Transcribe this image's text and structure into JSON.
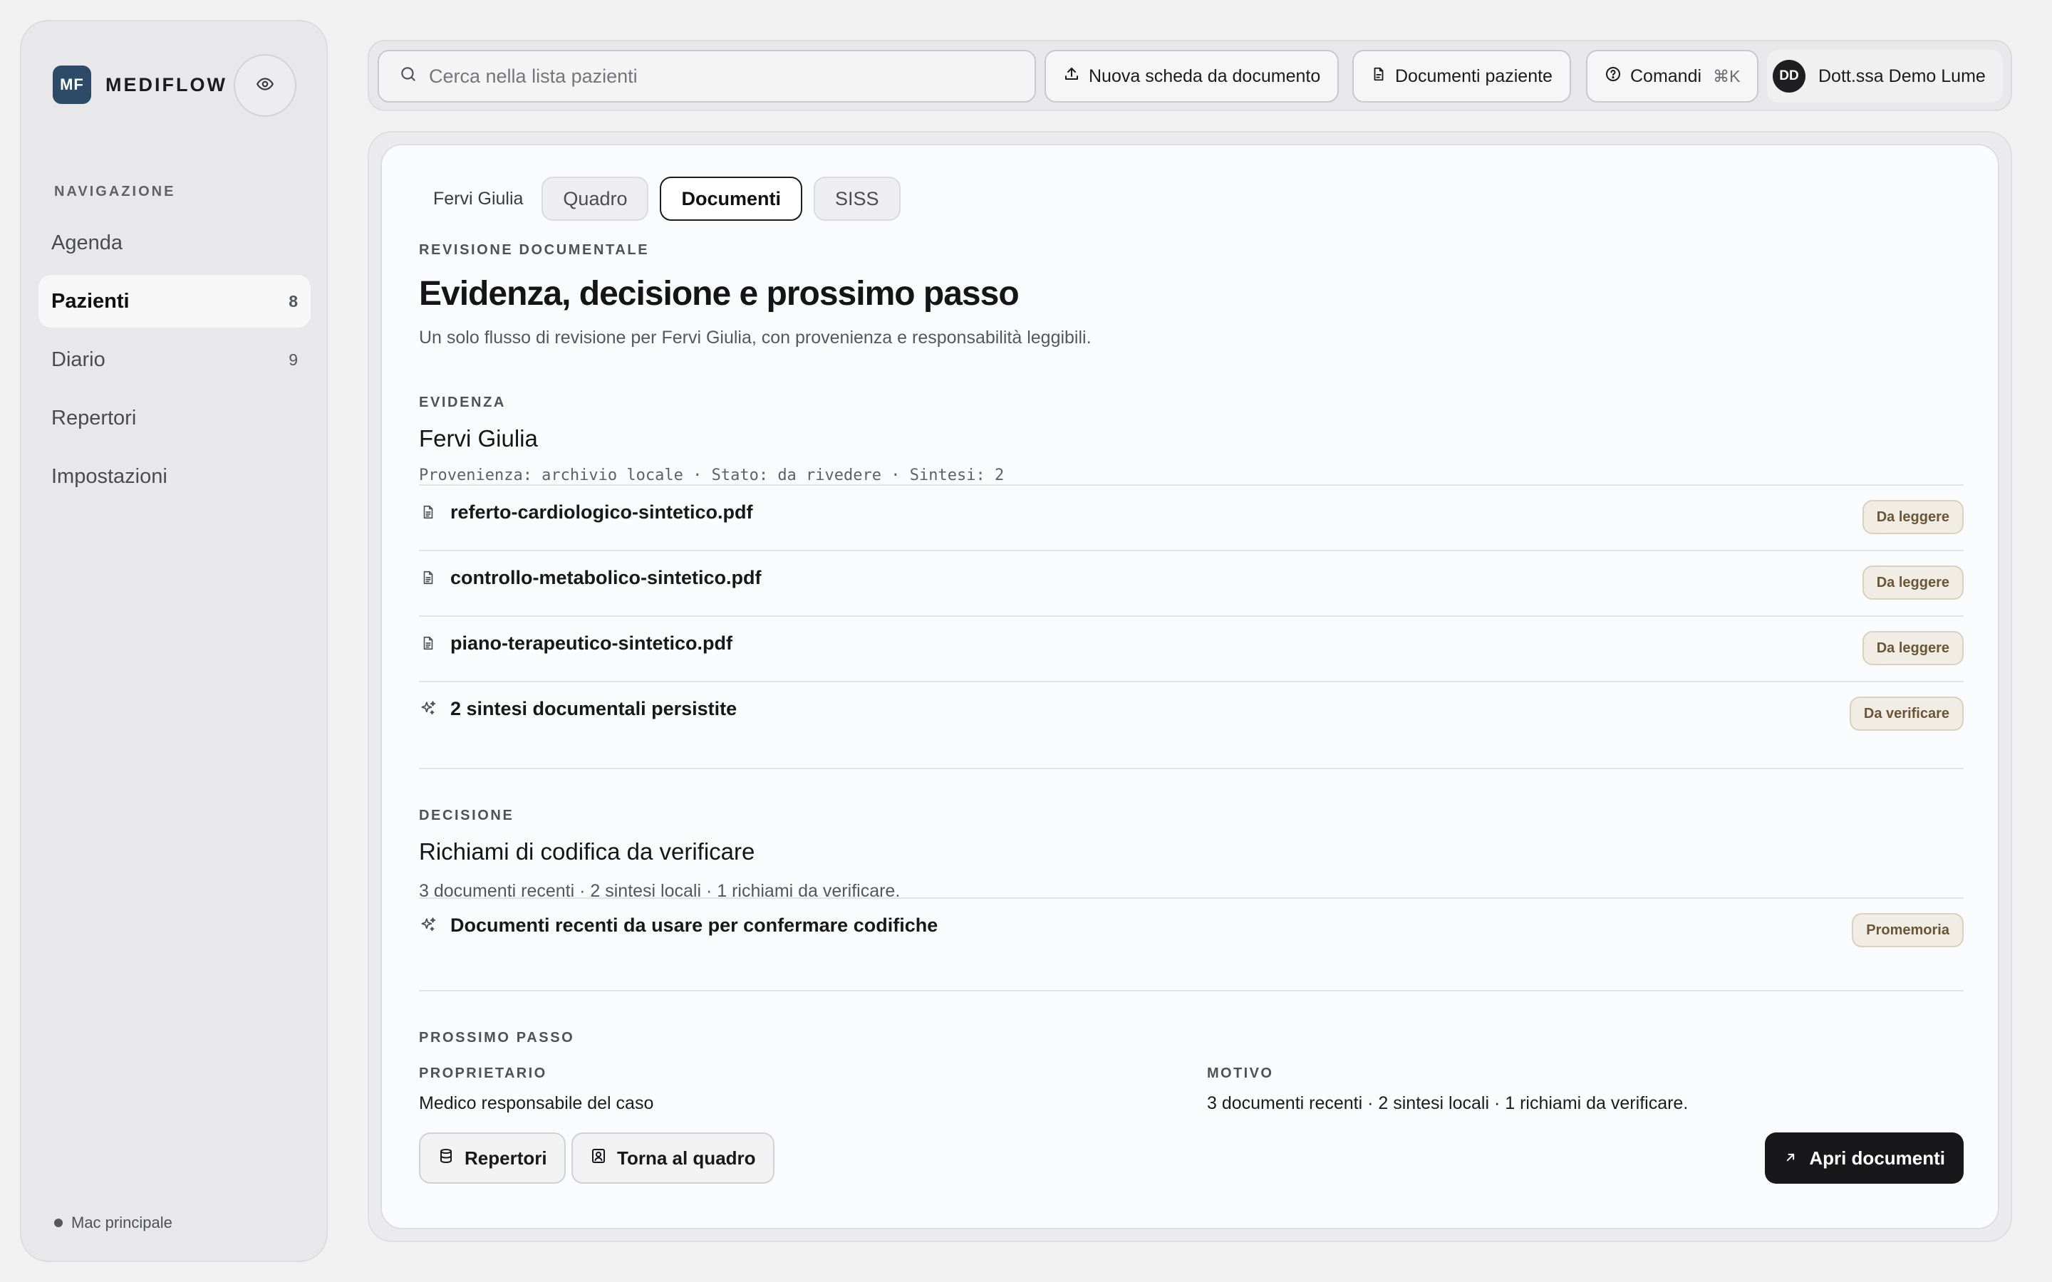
{
  "app": {
    "logo": "MF",
    "name": "MEDIFLOW"
  },
  "sidebar": {
    "heading": "NAVIGAZIONE",
    "items": [
      {
        "label": "Agenda",
        "count": ""
      },
      {
        "label": "Pazienti",
        "count": "8"
      },
      {
        "label": "Diario",
        "count": "9"
      },
      {
        "label": "Repertori",
        "count": ""
      },
      {
        "label": "Impostazioni",
        "count": ""
      }
    ],
    "footer": "Mac principale"
  },
  "topbar": {
    "search_placeholder": "Cerca nella lista pazienti",
    "new_doc": "Nuova scheda da documento",
    "patient_docs": "Documenti paziente",
    "commands": "Comandi",
    "commands_shortcut": "⌘K",
    "user_initials": "DD",
    "user_name": "Dott.ssa Demo Lume"
  },
  "tabs": {
    "patient": "Fervi Giulia",
    "items": [
      "Quadro",
      "Documenti",
      "SISS"
    ],
    "active": "Documenti"
  },
  "review": {
    "eyebrow": "REVISIONE DOCUMENTALE",
    "title": "Evidenza, decisione e prossimo passo",
    "subtitle": "Un solo flusso di revisione per Fervi Giulia, con provenienza e responsabilità leggibili."
  },
  "evidence": {
    "eyebrow": "EVIDENZA",
    "title": "Fervi Giulia",
    "meta": "Provenienza: archivio locale · Stato: da rivedere · Sintesi: 2",
    "rows": [
      {
        "icon": "document-icon",
        "label": "referto-cardiologico-sintetico.pdf",
        "badge": "Da leggere"
      },
      {
        "icon": "document-icon",
        "label": "controllo-metabolico-sintetico.pdf",
        "badge": "Da leggere"
      },
      {
        "icon": "document-icon",
        "label": "piano-terapeutico-sintetico.pdf",
        "badge": "Da leggere"
      },
      {
        "icon": "sparkles-icon",
        "label": "2 sintesi documentali persistite",
        "badge": "Da verificare"
      }
    ]
  },
  "decision": {
    "eyebrow": "DECISIONE",
    "title": "Richiami di codifica da verificare",
    "meta": "3 documenti recenti · 2 sintesi locali · 1 richiami da verificare.",
    "row": {
      "icon": "sparkles-icon",
      "label": "Documenti recenti da usare per confermare codifiche",
      "badge": "Promemoria"
    }
  },
  "next_step": {
    "eyebrow": "PROSSIMO PASSO",
    "owner_label": "PROPRIETARIO",
    "owner_value": "Medico responsabile del caso",
    "reason_label": "MOTIVO",
    "reason_value": "3 documenti recenti · 2 sintesi locali · 1 richiami da verificare.",
    "btn_repertori": "Repertori",
    "btn_back": "Torna al quadro",
    "btn_open": "Apri documenti"
  },
  "colors": {
    "brand": "#2d4a66",
    "primary_button": "#18181a",
    "badge_bg": "#f1ede5",
    "badge_text": "#6a5636"
  }
}
